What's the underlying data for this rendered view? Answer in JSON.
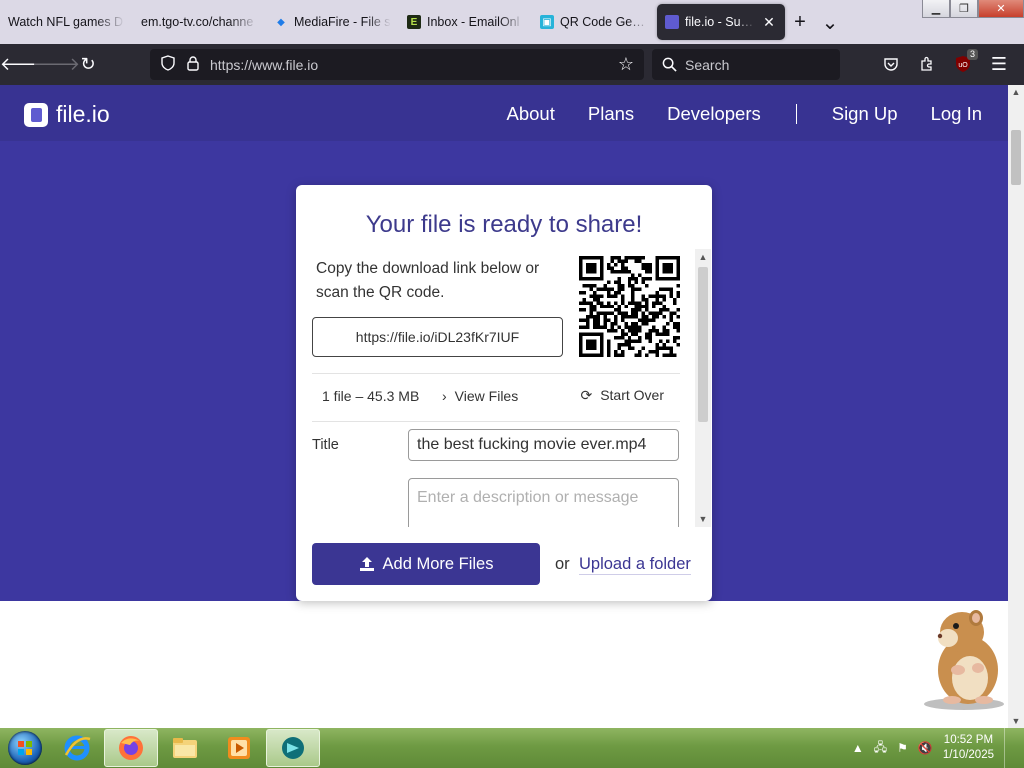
{
  "browser": {
    "tabs": [
      {
        "label": "Watch NFL games D",
        "favicon": "nfl-icon",
        "active": false
      },
      {
        "label": "em.tgo-tv.co/channe",
        "favicon": "page-icon",
        "active": false
      },
      {
        "label": "MediaFire - File s",
        "favicon": "mediafire-icon",
        "active": false
      },
      {
        "label": "Inbox - EmailOnl",
        "favicon": "emailondeck-icon",
        "active": false
      },
      {
        "label": "QR Code Genera",
        "favicon": "qr-icon",
        "active": false
      },
      {
        "label": "file.io - Super",
        "favicon": "fileio-icon",
        "active": true
      }
    ],
    "url": "https://www.file.io",
    "search_placeholder": "Search",
    "extension_badge": "3"
  },
  "site": {
    "logo_text": "file.io",
    "menu": [
      "About",
      "Plans",
      "Developers",
      "Sign Up",
      "Log In"
    ]
  },
  "card": {
    "heading": "Your file is ready to share!",
    "instructions": "Copy the download link below or scan the QR code.",
    "download_link": "https://file.io/iDL23fKr7IUF",
    "file_summary": "1 file – 45.3 MB",
    "view_files": "View Files",
    "start_over": "Start Over",
    "title_label": "Title",
    "title_value": "the best fucking movie ever.mp4",
    "description_placeholder": "Enter a description or message",
    "add_more_files": "Add More Files",
    "or_text": "or",
    "upload_folder": "Upload a folder"
  },
  "taskbar": {
    "pinned": [
      "ie-icon",
      "firefox-icon",
      "explorer-icon",
      "media-player-icon",
      "app-icon"
    ],
    "time": "10:52 PM",
    "date": "1/10/2025"
  },
  "colors": {
    "brand": "#383392",
    "hero": "#3d37a0",
    "button": "#3b3693"
  }
}
